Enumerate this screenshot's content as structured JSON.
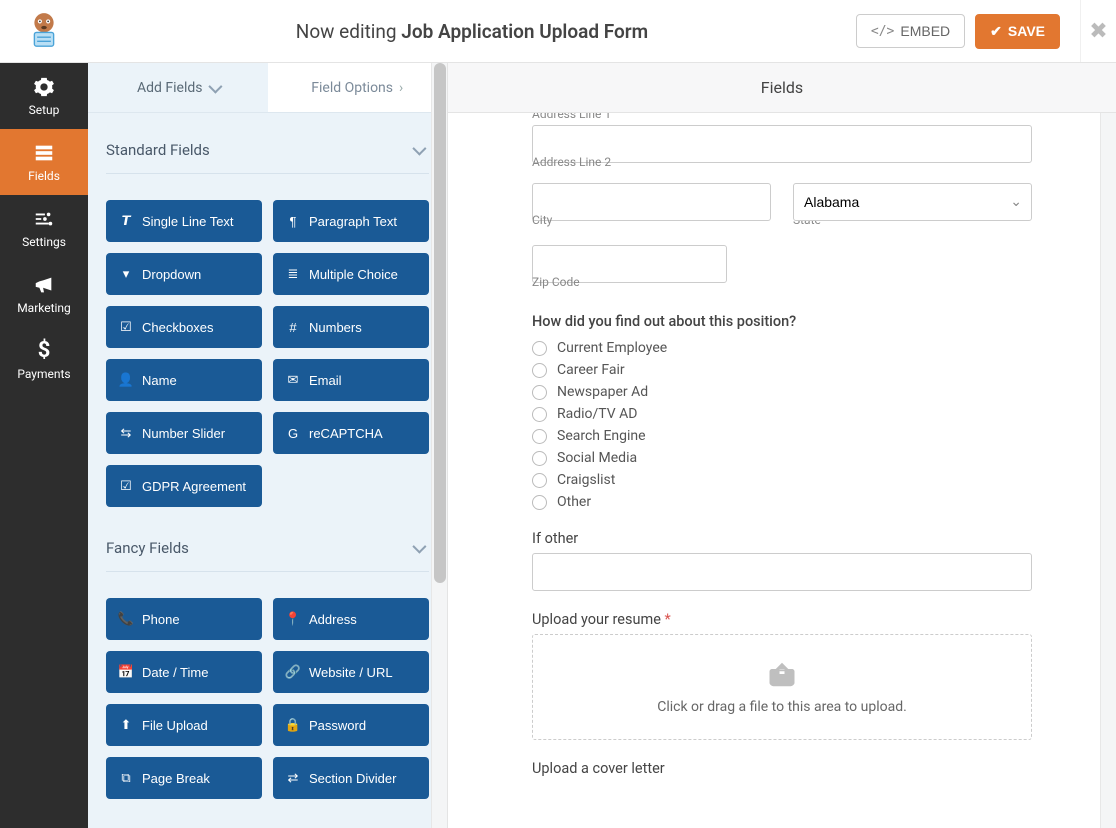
{
  "header": {
    "editing_prefix": "Now editing ",
    "form_name": "Job Application Upload Form",
    "embed_label": "EMBED",
    "save_label": "SAVE"
  },
  "leftnav": {
    "setup": "Setup",
    "fields": "Fields",
    "settings": "Settings",
    "marketing": "Marketing",
    "payments": "Payments"
  },
  "panel": {
    "tab_add": "Add Fields",
    "tab_options": "Field Options",
    "section_standard": "Standard Fields",
    "section_fancy": "Fancy Fields",
    "standard_fields": [
      "Single Line Text",
      "Paragraph Text",
      "Dropdown",
      "Multiple Choice",
      "Checkboxes",
      "Numbers",
      "Name",
      "Email",
      "Number Slider",
      "reCAPTCHA",
      "GDPR Agreement"
    ],
    "fancy_fields": [
      "Phone",
      "Address",
      "Date / Time",
      "Website / URL",
      "File Upload",
      "Password",
      "Page Break",
      "Section Divider"
    ]
  },
  "preview": {
    "title": "Fields",
    "address_line1_sub": "Address Line 1",
    "address_line2_sub": "Address Line 2",
    "city_sub": "City",
    "state_sub": "State",
    "state_value": "Alabama",
    "zip_sub": "Zip Code",
    "question_label": "How did you find out about this position?",
    "radio_options": [
      "Current Employee",
      "Career Fair",
      "Newspaper Ad",
      "Radio/TV AD",
      "Search Engine",
      "Social Media",
      "Craigslist",
      "Other"
    ],
    "if_other_label": "If other",
    "upload_resume_label": "Upload your resume",
    "upload_hint": "Click or drag a file to this area to upload.",
    "upload_cover_label": "Upload a cover letter"
  }
}
